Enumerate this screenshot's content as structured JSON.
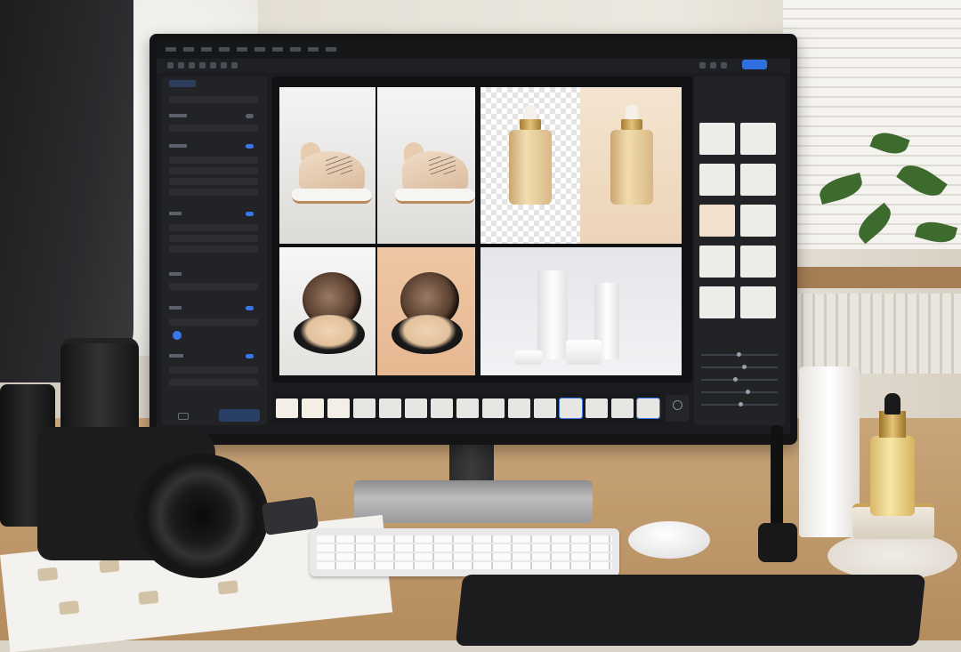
{
  "scene": {
    "description_free": true
  },
  "app": {
    "menu": [
      "",
      "",
      "",
      "",
      "",
      "",
      "",
      "",
      "",
      "",
      "",
      ""
    ],
    "share_label": "",
    "export_label": "",
    "left_panel": {
      "tabs": [
        "",
        ""
      ],
      "rows": [
        "",
        "",
        "",
        "",
        "",
        "",
        "",
        "",
        "",
        "",
        "",
        ""
      ]
    },
    "right_panel": {
      "tabs": [
        "",
        "",
        ""
      ]
    }
  },
  "colors": {
    "accent": "#3a78ea",
    "screen_bg": "#1b1c1f",
    "panel_bg": "#222327"
  },
  "icons": {
    "share": "share-icon",
    "next": "chevron-right-icon"
  }
}
